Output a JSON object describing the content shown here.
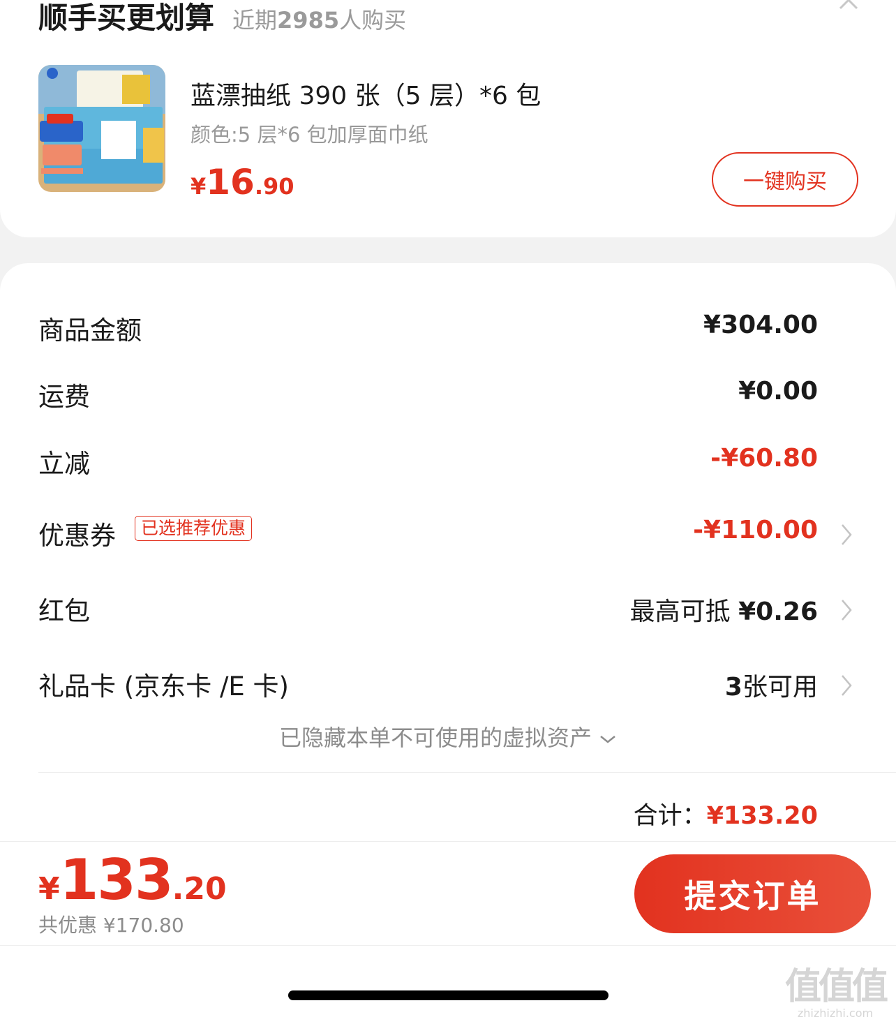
{
  "upsell": {
    "title": "顺手买更划算",
    "sub_prefix": "近期",
    "sub_count": "2985",
    "sub_suffix": "人购买",
    "product": {
      "name": "蓝漂抽纸 390 张（5 层）*6 包",
      "spec": "颜色:5 层*6 包加厚面巾纸",
      "price_currency": "¥",
      "price_int": "16",
      "price_dec": ".90",
      "buy_label": "一键购买"
    }
  },
  "summary": {
    "goods": {
      "label": "商品金额",
      "value": "¥304.00"
    },
    "shipping": {
      "label": "运费",
      "value": "¥0.00"
    },
    "discount": {
      "label": "立减",
      "value": "-¥60.80"
    },
    "coupon": {
      "label": "优惠券",
      "badge": "已选推荐优惠",
      "value": "-¥110.00"
    },
    "redpacket": {
      "label": "红包",
      "value_prefix": "最高可抵 ",
      "value": "¥0.26"
    },
    "giftcard": {
      "label": "礼品卡 (京东卡 /E 卡)",
      "value_num": "3",
      "value_suffix": "张可用"
    },
    "hidden_note": "已隐藏本单不可使用的虚拟资产",
    "total_label": "合计：",
    "total_value": "¥133.20"
  },
  "bottom": {
    "price_currency": "¥",
    "price_int": "133",
    "price_dec": ".20",
    "saved": "共优惠 ¥170.80",
    "submit_label": "提交订单"
  },
  "watermark": {
    "big": "值值值",
    "small": "zhizhizhi.com"
  },
  "colors": {
    "accent": "#e2321f",
    "muted": "#999999",
    "background": "#f2f2f2"
  }
}
